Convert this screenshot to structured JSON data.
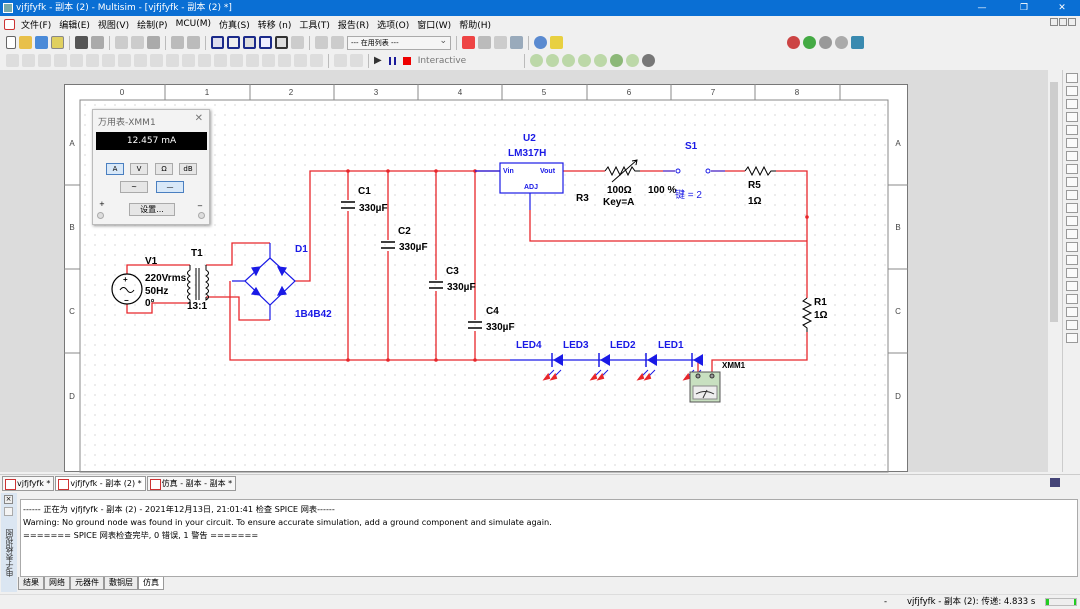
{
  "window": {
    "title": "vjfjfyfk - 副本 (2) - Multisim - [vjfjfyfk - 副本 (2) *]",
    "min": "—",
    "max": "❐",
    "close": "✕"
  },
  "menu": [
    "文件(F)",
    "编辑(E)",
    "视图(V)",
    "绘制(P)",
    "MCU(M)",
    "仿真(S)",
    "转移 (n)",
    "工具(T)",
    "报告(R)",
    "选项(O)",
    "窗口(W)",
    "帮助(H)"
  ],
  "toolbar": {
    "in_use_list": "--- 在用列表 ---",
    "interactive": "Interactive"
  },
  "sheet": {
    "columns": [
      "0",
      "1",
      "2",
      "3",
      "4",
      "5",
      "6",
      "7",
      "8"
    ],
    "rows": [
      "A",
      "B",
      "C",
      "D"
    ]
  },
  "multimeter": {
    "title": "万用表-XMM1",
    "reading": "12.457 mA",
    "modes": [
      "A",
      "V",
      "Ω",
      "dB"
    ],
    "selected_mode": "A",
    "waveforms": [
      "~",
      "—"
    ],
    "selected_waveform": "DC",
    "settings": "设置...",
    "plus": "+",
    "minus": "−",
    "close": "✕"
  },
  "components": {
    "v1": {
      "name": "V1",
      "v": "220Vrms",
      "f": "50Hz",
      "ph": "0°"
    },
    "t1": {
      "name": "T1",
      "ratio": "13:1"
    },
    "d1": {
      "name": "D1",
      "model": "1B4B42"
    },
    "c1": {
      "name": "C1",
      "value": "330µF"
    },
    "c2": {
      "name": "C2",
      "value": "330µF"
    },
    "c3": {
      "name": "C3",
      "value": "330µF"
    },
    "c4": {
      "name": "C4",
      "value": "330µF"
    },
    "u2": {
      "name": "U2",
      "model": "LM317H",
      "vin": "Vin",
      "vout": "Vout",
      "adj": "ADJ"
    },
    "r3": {
      "name": "R3",
      "value": "100Ω",
      "key": "Key=A",
      "percent": "100 %"
    },
    "s1": {
      "name": "S1",
      "key": "键 = 2"
    },
    "r5": {
      "name": "R5",
      "value": "1Ω"
    },
    "r1": {
      "name": "R1",
      "value": "1Ω"
    },
    "leds": [
      "LED4",
      "LED3",
      "LED2",
      "LED1"
    ],
    "xmm1": {
      "name": "XMM1",
      "minus": "−",
      "plus": "+"
    }
  },
  "colors": {
    "wire": "#e8262b",
    "component": "#1a1ae6",
    "title_bar": "#0a6fd4"
  },
  "doc_tabs": [
    "vjfjfyfk *",
    "vjfjfyfk - 副本 (2) *",
    "仿真 - 副本 - 副本 *"
  ],
  "active_doc_tab": 1,
  "spreadsheet": {
    "side_label": "电子表格视图",
    "log": [
      "------ 正在为 vjfjfyfk - 副本 (2) - 2021年12月13日, 21:01:41 检查 SPICE 网表------",
      "Warning: No ground node was found in your circuit. To ensure accurate simulation, add a ground component and simulate again.",
      "======= SPICE 网表检查完毕, 0 错误, 1 警告 ======="
    ],
    "tabs": [
      "结果",
      "网络",
      "元器件",
      "敷铜层",
      "仿真"
    ],
    "active_tab": "仿真"
  },
  "status": {
    "dash": "-",
    "sim": "vjfjfyfk - 副本 (2): 传递: 4.833 s"
  }
}
